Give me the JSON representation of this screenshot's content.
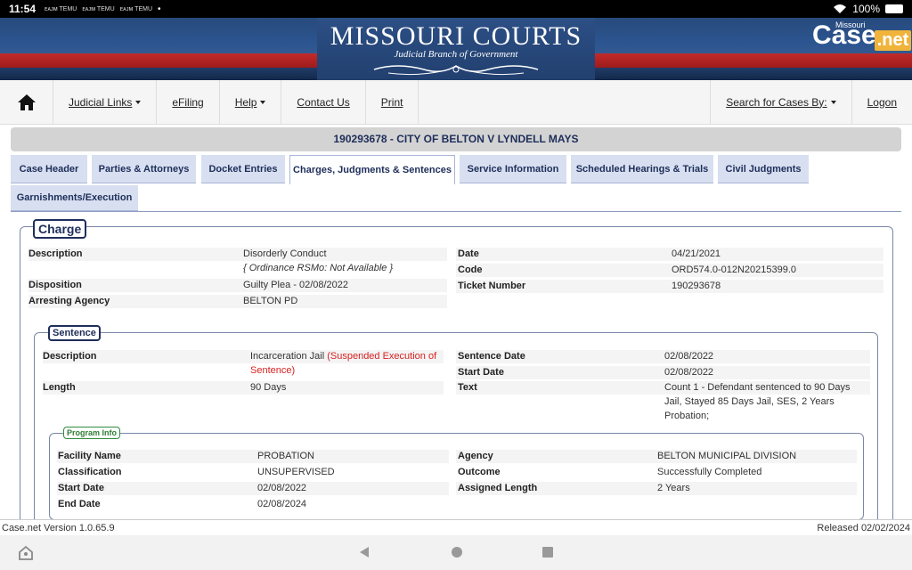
{
  "status_bar": {
    "time": "11:54",
    "indicators": [
      "ᴇᴀᴊᴍ TEMU",
      "ᴇᴀᴊᴍ TEMU",
      "ᴇᴀᴊᴍ TEMU"
    ],
    "battery": "100%"
  },
  "banner": {
    "title": "MISSOURI COURTS",
    "subtitle": "Judicial Branch of Government",
    "casenet_small": "Missouri",
    "casenet_main": "Case",
    "casenet_suffix": ".net"
  },
  "nav": {
    "home_icon": "home-icon",
    "items": [
      "Judicial Links",
      "eFiling",
      "Help",
      "Contact Us",
      "Print"
    ],
    "search": "Search for Cases By:",
    "logon": "Logon"
  },
  "case_title": "190293678 - CITY OF BELTON V LYNDELL MAYS",
  "tabs": [
    "Case Header",
    "Parties & Attorneys",
    "Docket Entries",
    "Charges, Judgments & Sentences",
    "Service Information",
    "Scheduled Hearings & Trials",
    "Civil Judgments",
    "Garnishments/Execution"
  ],
  "charge": {
    "legend": "Charge",
    "description_label": "Description",
    "description_value": "Disorderly Conduct",
    "description_note": "{ Ordinance RSMo: Not Available }",
    "disposition_label": "Disposition",
    "disposition_value": "Guilty Plea - 02/08/2022",
    "agency_label": "Arresting Agency",
    "agency_value": "BELTON PD",
    "date_label": "Date",
    "date_value": "04/21/2021",
    "code_label": "Code",
    "code_value": "ORD574.0-012N20215399.0",
    "ticket_label": "Ticket Number",
    "ticket_value": "190293678"
  },
  "sentence": {
    "legend": "Sentence",
    "description_label": "Description",
    "description_value": "Incarceration Jail",
    "description_red_1": "(Suspended Execution of",
    "description_red_2": "Sentence)",
    "length_label": "Length",
    "length_value": "90 Days",
    "sentence_date_label": "Sentence Date",
    "sentence_date_value": "02/08/2022",
    "start_date_label": "Start Date",
    "start_date_value": "02/08/2022",
    "text_label": "Text",
    "text_line1": "Count 1 - Defendant sentenced to 90 Days",
    "text_line2": "Jail, Stayed 85 Days Jail, SES, 2 Years",
    "text_line3": "Probation;"
  },
  "program": {
    "legend": "Program Info",
    "facility_label": "Facility Name",
    "facility_value": "PROBATION",
    "classification_label": "Classification",
    "classification_value": "UNSUPERVISED",
    "start_label": "Start Date",
    "start_value": "02/08/2022",
    "end_label": "End Date",
    "end_value": "02/08/2024",
    "agency_label": "Agency",
    "agency_value": "BELTON MUNICIPAL DIVISION",
    "outcome_label": "Outcome",
    "outcome_value": "Successfully Completed",
    "assigned_label": "Assigned Length",
    "assigned_value": "2 Years"
  },
  "footer": {
    "version": "Case.net Version 1.0.65.9",
    "released": "Released 02/02/2024"
  }
}
